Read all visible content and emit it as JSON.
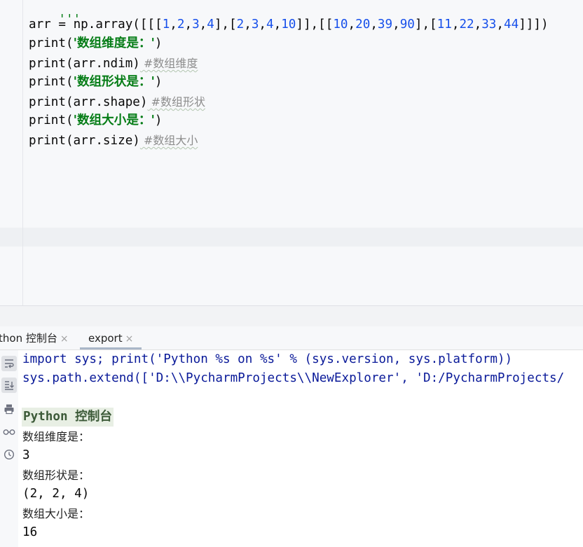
{
  "editor": {
    "docstring_fragment": "'''",
    "line1": {
      "var": "arr",
      "op": " = ",
      "call": "np.array(",
      "p1": "[[[",
      "n1": "1",
      "c1": ",",
      "n2": "2",
      "c2": ",",
      "n3": "3",
      "c3": ",",
      "n4": "4",
      "p2": "],[",
      "n5": "2",
      "c5": ",",
      "n6": "3",
      "c6": ",",
      "n7": "4",
      "c7": ",",
      "n8": "10",
      "p3": "]],[[",
      "n9": "10",
      "c9": ",",
      "n10": "20",
      "c10": ",",
      "n11": "39",
      "c11": ",",
      "n12": "90",
      "p4": "],[",
      "n13": "11",
      "c13": ",",
      "n14": "22",
      "c14": ",",
      "n15": "33",
      "c15": ",",
      "n16": "44",
      "p5": "]]])"
    },
    "line2": {
      "fn": "print(",
      "str": "'数组维度是：'",
      "close": ")"
    },
    "line3": {
      "code": "print(arr.ndim)",
      "comment": " #数组维度"
    },
    "line4": {
      "fn": "print(",
      "str": "'数组形状是：'",
      "close": ")"
    },
    "line5": {
      "code": "print(arr.shape)",
      "comment": " #数组形状"
    },
    "line6": {
      "fn": "print(",
      "str": "'数组大小是：'",
      "close": ")"
    },
    "line7": {
      "code": "print(arr.size)",
      "comment": " #数组大小"
    }
  },
  "tabs": [
    {
      "label": "thon 控制台",
      "close": "×"
    },
    {
      "label": "export",
      "close": "×"
    }
  ],
  "tool_icons": [
    "soft-wrap-icon",
    "scroll-to-end-icon",
    "print-icon",
    "glasses-icon",
    "history-icon"
  ],
  "console": {
    "cmd1": "import sys; print('Python %s on %s' % (sys.version, sys.platform))",
    "cmd2": "sys.path.extend(['D:\\\\PycharmProjects\\\\NewExplorer', 'D:/PycharmProjects/",
    "banner": "Python 控制台",
    "out1": "数组维度是：",
    "out2": "3",
    "out3": "数组形状是：",
    "out4": "(2, 2, 4)",
    "out5": "数组大小是：",
    "out6": "16"
  }
}
